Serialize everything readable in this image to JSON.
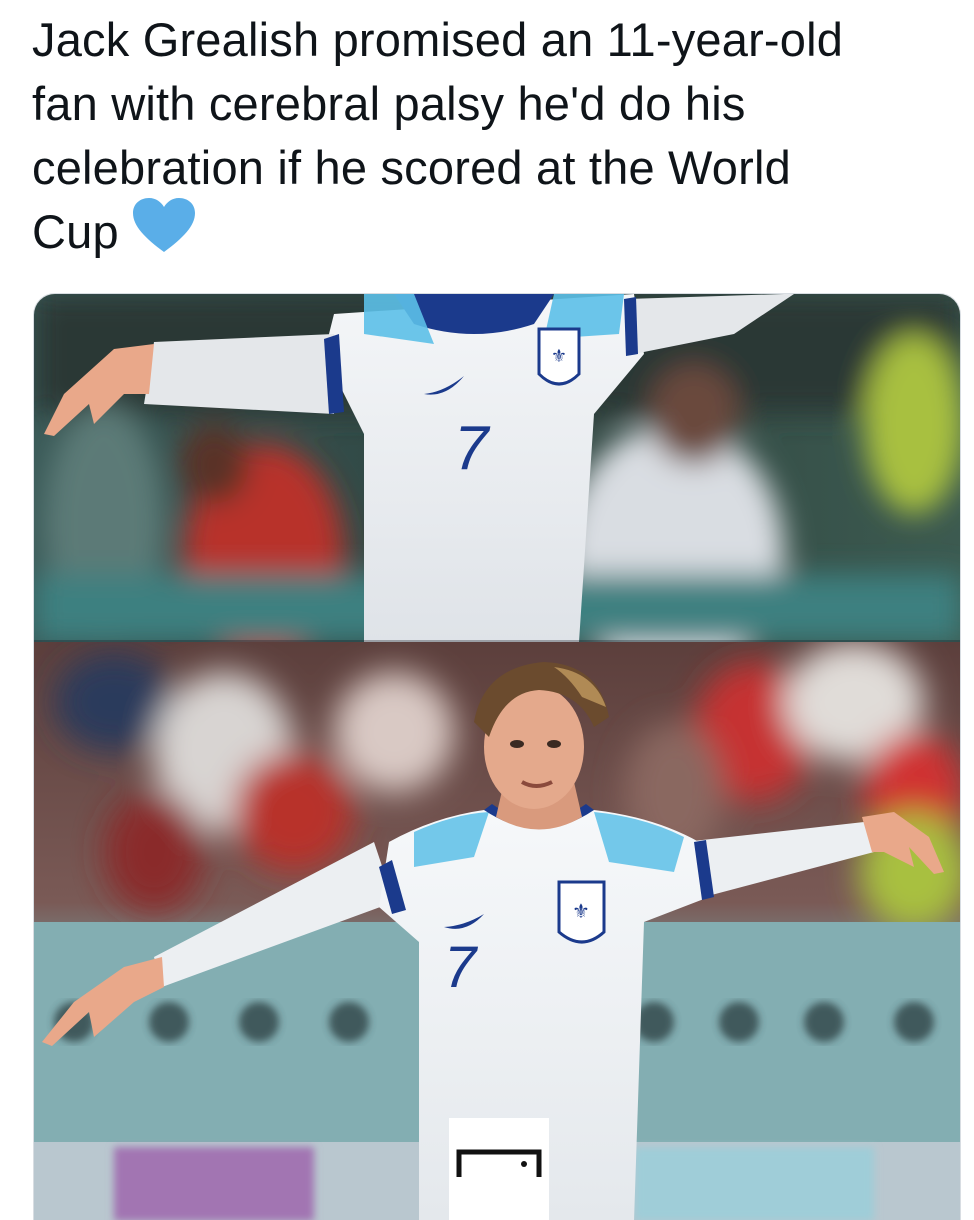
{
  "tweet": {
    "text_lines": [
      "Jack Grealish promised an 11-year-old",
      "fan with cerebral palsy he'd do his",
      "celebration if he scored at the World",
      "Cup"
    ],
    "emoji": "blue-heart-icon",
    "accent_color": "#5aaee8"
  },
  "media": {
    "shirt_number": "7",
    "photos": [
      "top-photo",
      "bottom-photo"
    ]
  }
}
